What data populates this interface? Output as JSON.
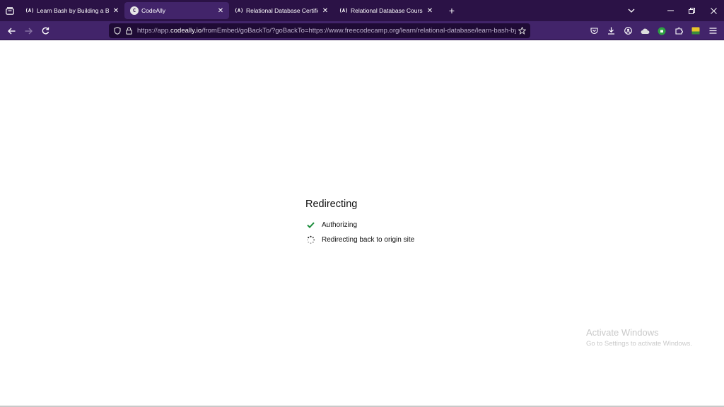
{
  "browser": {
    "tabs": [
      {
        "favicon": "(A)",
        "title": "Learn Bash by Building a Boilerplate",
        "active": false
      },
      {
        "favicon": "C",
        "title": "CodeAlly",
        "active": true
      },
      {
        "favicon": "(A)",
        "title": "Relational Database Certification",
        "active": false
      },
      {
        "favicon": "(A)",
        "title": "Relational Database Course – H",
        "active": false
      }
    ],
    "url": {
      "prefix": "https://app.",
      "host": "codeally.io",
      "rest": "/fromEmbed/goBackTo/?goBackTo=https://www.freecodecamp.org/learn/relational-database/learn-bash-by-"
    },
    "icons": {
      "tab_list": "tab-list-icon",
      "new_tab": "+",
      "back": "←",
      "forward": "→",
      "reload": "↻",
      "close": "✕"
    }
  },
  "page": {
    "title": "Redirecting",
    "steps": [
      {
        "label": "Authorizing",
        "status": "done"
      },
      {
        "label": "Redirecting back to origin site",
        "status": "loading"
      }
    ]
  },
  "watermark": {
    "heading": "Activate Windows",
    "subtext": "Go to Settings to activate Windows."
  },
  "colors": {
    "tabstrip": "#2b1246",
    "navbar": "#42246a",
    "check": "#1e8e3e"
  }
}
